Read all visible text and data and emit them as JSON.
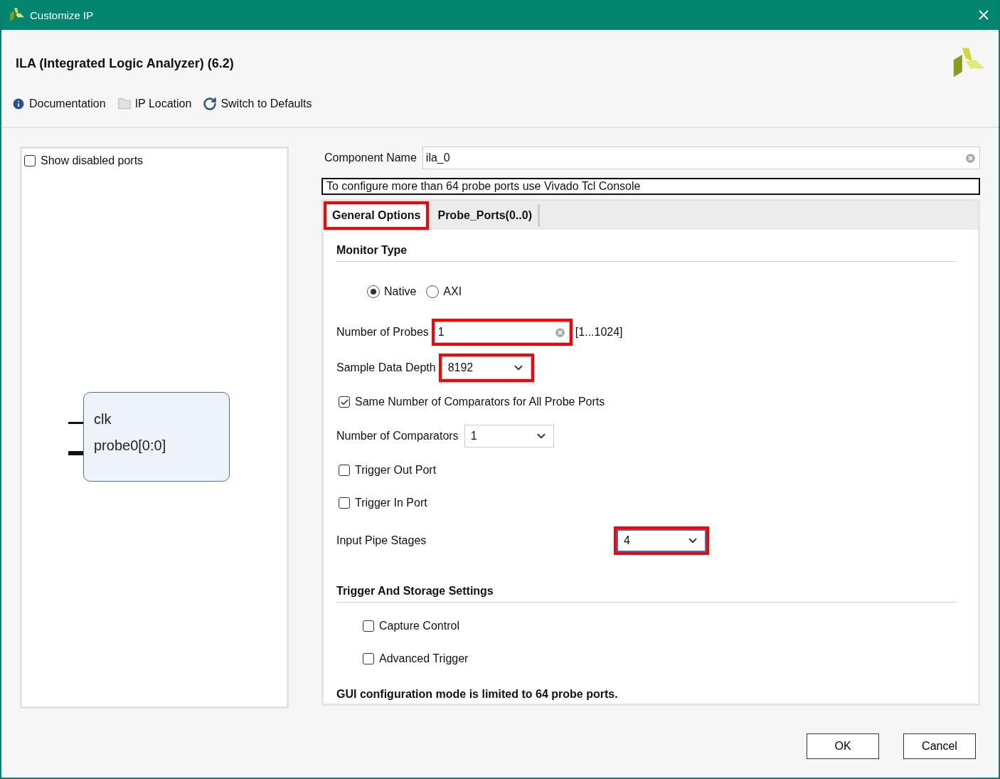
{
  "window": {
    "title": "Customize IP"
  },
  "header": {
    "title": "ILA (Integrated Logic Analyzer) (6.2)"
  },
  "toolbar": [
    {
      "kind": "info",
      "label": "Documentation"
    },
    {
      "kind": "folder",
      "label": "IP Location"
    },
    {
      "kind": "refresh",
      "label": "Switch to Defaults"
    }
  ],
  "symbol_panel": {
    "show_disabled": {
      "label": "Show disabled ports",
      "checked": false
    },
    "ports": [
      {
        "name": "clk",
        "bus": false
      },
      {
        "name": "probe0[0:0]",
        "bus": true
      }
    ]
  },
  "component_name": {
    "label": "Component Name",
    "value": "ila_0"
  },
  "notice": "To configure more than 64 probe ports use Vivado Tcl Console",
  "tabs": [
    {
      "label": "General Options",
      "selected": true,
      "highlighted": true
    },
    {
      "label": "Probe_Ports(0..0)",
      "selected": false,
      "highlighted": false
    }
  ],
  "sections": [
    {
      "title": "Monitor Type",
      "rows": [
        {
          "kind": "radio",
          "options": [
            {
              "label": "Native",
              "selected": true
            },
            {
              "label": "AXI",
              "selected": false
            }
          ]
        },
        {
          "kind": "text",
          "label": "Number of Probes",
          "value": "1",
          "range": "[1...1024]",
          "highlighted": true
        },
        {
          "kind": "select",
          "label": "Sample Data Depth",
          "value": "8192",
          "highlighted": true,
          "focused": false,
          "wide_label": false
        },
        {
          "kind": "checkbox",
          "label": "Same Number of Comparators for All Probe Ports",
          "checked": true
        },
        {
          "kind": "select",
          "label": "Number of Comparators",
          "value": "1",
          "highlighted": false,
          "focused": false,
          "wide_label": false
        },
        {
          "kind": "checkbox",
          "label": "Trigger Out Port",
          "checked": false
        },
        {
          "kind": "checkbox",
          "label": "Trigger In Port",
          "checked": false
        },
        {
          "kind": "select",
          "label": "Input Pipe Stages",
          "value": "4",
          "highlighted": true,
          "focused": true,
          "wide_label": true
        }
      ]
    },
    {
      "title": "Trigger And Storage Settings",
      "rows": [
        {
          "kind": "indented_checkbox",
          "label": "Capture Control",
          "checked": false
        },
        {
          "kind": "indented_checkbox",
          "label": "Advanced Trigger",
          "checked": false
        }
      ]
    }
  ],
  "footnote": "GUI configuration mode is limited to 64 probe ports.",
  "buttons": [
    "OK",
    "Cancel"
  ]
}
